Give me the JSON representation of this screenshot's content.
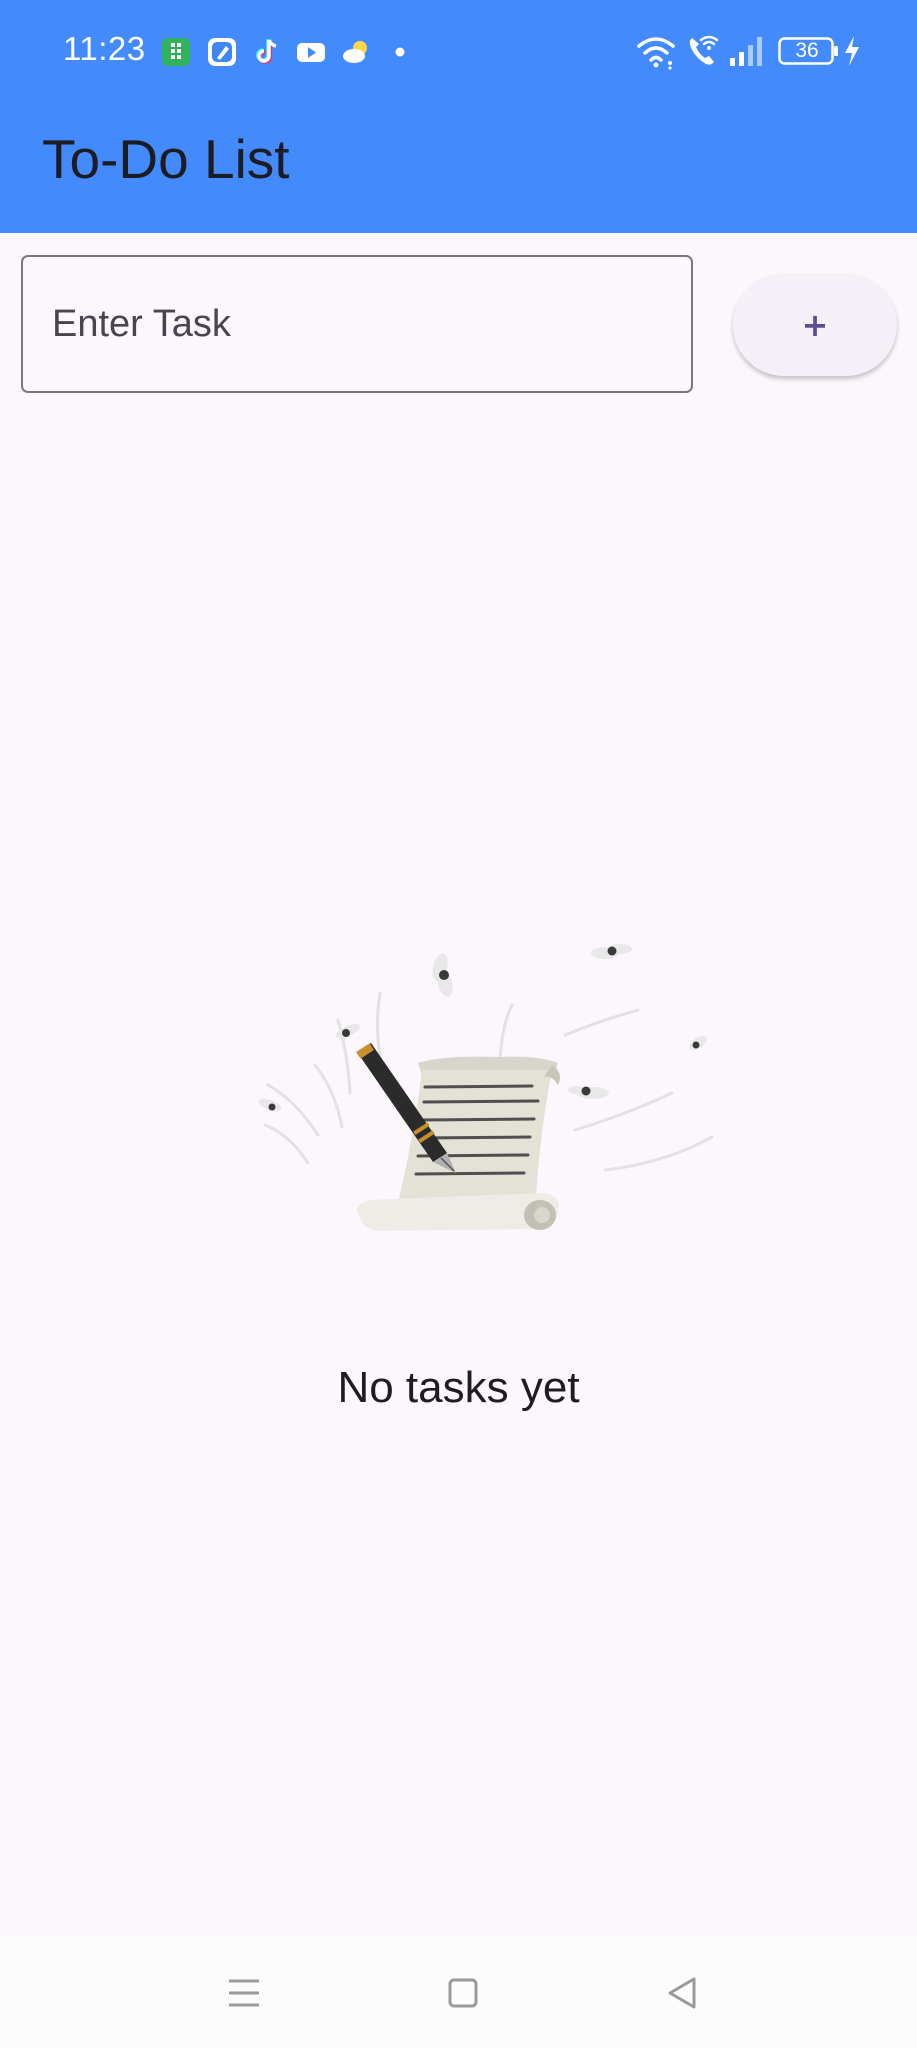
{
  "status_bar": {
    "time": "11:23",
    "battery_level": "36",
    "notification_icons": [
      "calculator-app-icon",
      "notes-app-icon",
      "tiktok-icon",
      "youtube-icon",
      "weather-icon",
      "more-dot-icon"
    ],
    "system_icons": [
      "wifi-icon",
      "wifi-calling-icon",
      "cellular-signal-icon",
      "battery-icon",
      "charging-bolt-icon"
    ]
  },
  "app_bar": {
    "title": "To-Do List"
  },
  "task_entry": {
    "placeholder": "Enter Task",
    "value": "",
    "add_label": "+"
  },
  "empty_state": {
    "illustration": "scroll-and-pen-illustration",
    "message": "No tasks yet"
  },
  "navigation": {
    "buttons": [
      "menu-icon",
      "home-square-icon",
      "back-triangle-icon"
    ]
  },
  "colors": {
    "app_bar": "#438afc",
    "background": "#fcf6fd",
    "button_background": "#f4f0f7",
    "button_text": "#5e4c97",
    "input_border": "#7b7680",
    "title_text": "#1d1c22"
  }
}
